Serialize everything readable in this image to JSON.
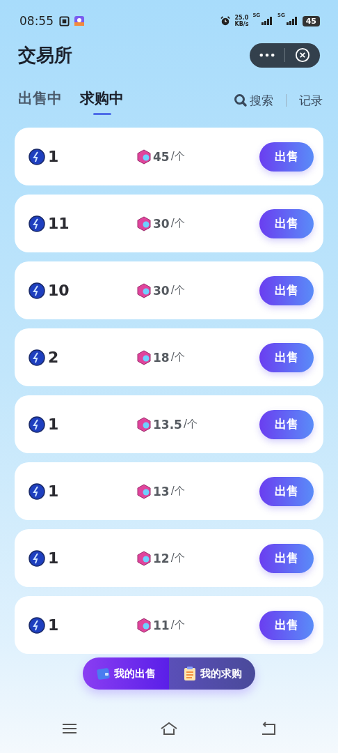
{
  "status_bar": {
    "time": "08:55",
    "speed_value": "25.0",
    "speed_unit": "KB/s",
    "network_1": "5G",
    "network_2": "5G",
    "battery": "45"
  },
  "header": {
    "title": "交易所"
  },
  "tabs": [
    {
      "label": "出售中",
      "selected": false
    },
    {
      "label": "求购中",
      "selected": true
    }
  ],
  "actions": {
    "search": "搜索",
    "records": "记录"
  },
  "orders": [
    {
      "quantity": "1",
      "price": "45",
      "unit": "/个",
      "button": "出售"
    },
    {
      "quantity": "11",
      "price": "30",
      "unit": "/个",
      "button": "出售"
    },
    {
      "quantity": "10",
      "price": "30",
      "unit": "/个",
      "button": "出售"
    },
    {
      "quantity": "2",
      "price": "18",
      "unit": "/个",
      "button": "出售"
    },
    {
      "quantity": "1",
      "price": "13.5",
      "unit": "/个",
      "button": "出售"
    },
    {
      "quantity": "1",
      "price": "13",
      "unit": "/个",
      "button": "出售"
    },
    {
      "quantity": "1",
      "price": "12",
      "unit": "/个",
      "button": "出售"
    },
    {
      "quantity": "1",
      "price": "11",
      "unit": "/个",
      "button": "出售"
    }
  ],
  "bottom_buttons": [
    {
      "label": "我的出售",
      "kind": "sell"
    },
    {
      "label": "我的求购",
      "kind": "buy"
    }
  ]
}
